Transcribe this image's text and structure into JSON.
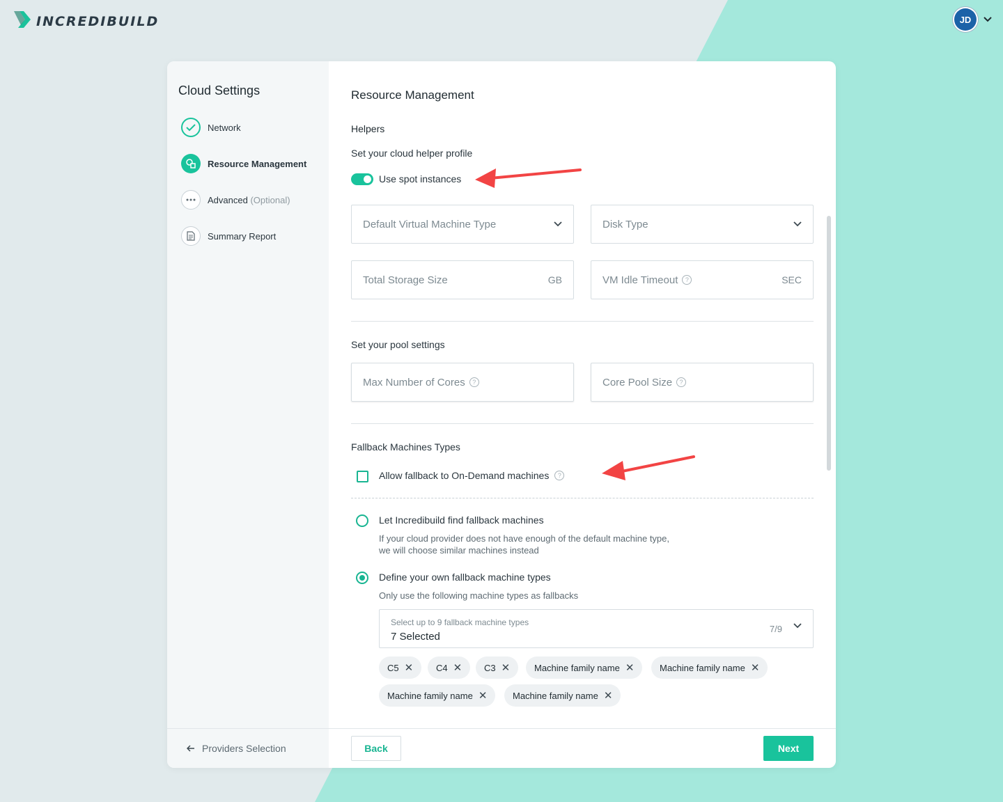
{
  "brand": {
    "name": "INCREDIBUILD",
    "accent": "#19c39c",
    "mint": "#a4e8dc"
  },
  "user": {
    "initials": "JD"
  },
  "sidebar": {
    "title": "Cloud Settings",
    "steps": [
      {
        "label": "Network",
        "state": "done",
        "icon": "check-icon"
      },
      {
        "label": "Resource Management",
        "state": "active",
        "icon": "resources-icon"
      },
      {
        "label": "Advanced",
        "optional": "(Optional)",
        "state": "pending",
        "icon": "more-dots-icon"
      },
      {
        "label": "Summary Report",
        "state": "pending",
        "icon": "document-icon"
      }
    ],
    "footer_link": "Providers Selection"
  },
  "main": {
    "title": "Resource Management",
    "helpers": {
      "heading": "Helpers",
      "profile_label": "Set your cloud helper profile",
      "spot_toggle_label": "Use spot instances",
      "spot_toggle_on": true,
      "vm_type_placeholder": "Default Virtual Machine Type",
      "disk_type_placeholder": "Disk Type",
      "storage_placeholder": "Total Storage Size",
      "storage_unit": "GB",
      "idle_timeout_placeholder": "VM Idle Timeout",
      "idle_timeout_unit": "SEC"
    },
    "pool": {
      "heading": "Set your pool settings",
      "max_cores_placeholder": "Max Number of Cores",
      "core_pool_placeholder": "Core Pool Size"
    },
    "fallback": {
      "heading": "Fallback Machines Types",
      "allow_label": "Allow fallback to On-Demand machines",
      "allow_checked": false,
      "option_auto_label": "Let Incredibuild find fallback machines",
      "option_auto_desc_1": "If your cloud provider does not have enough of the default machine type,",
      "option_auto_desc_2": "we will choose similar machines instead",
      "option_custom_label": "Define your own fallback machine types",
      "option_custom_desc": "Only use the following machine types as fallbacks",
      "selected_option": "custom",
      "select_placeholder": "Select up to 9 fallback machine types",
      "select_value": "7 Selected",
      "select_count": "7/9",
      "chips": [
        "C5",
        "C4",
        "C3",
        "Machine family name",
        "Machine family name",
        "Machine family name",
        "Machine family name"
      ]
    },
    "buttons": {
      "back": "Back",
      "next": "Next"
    }
  }
}
